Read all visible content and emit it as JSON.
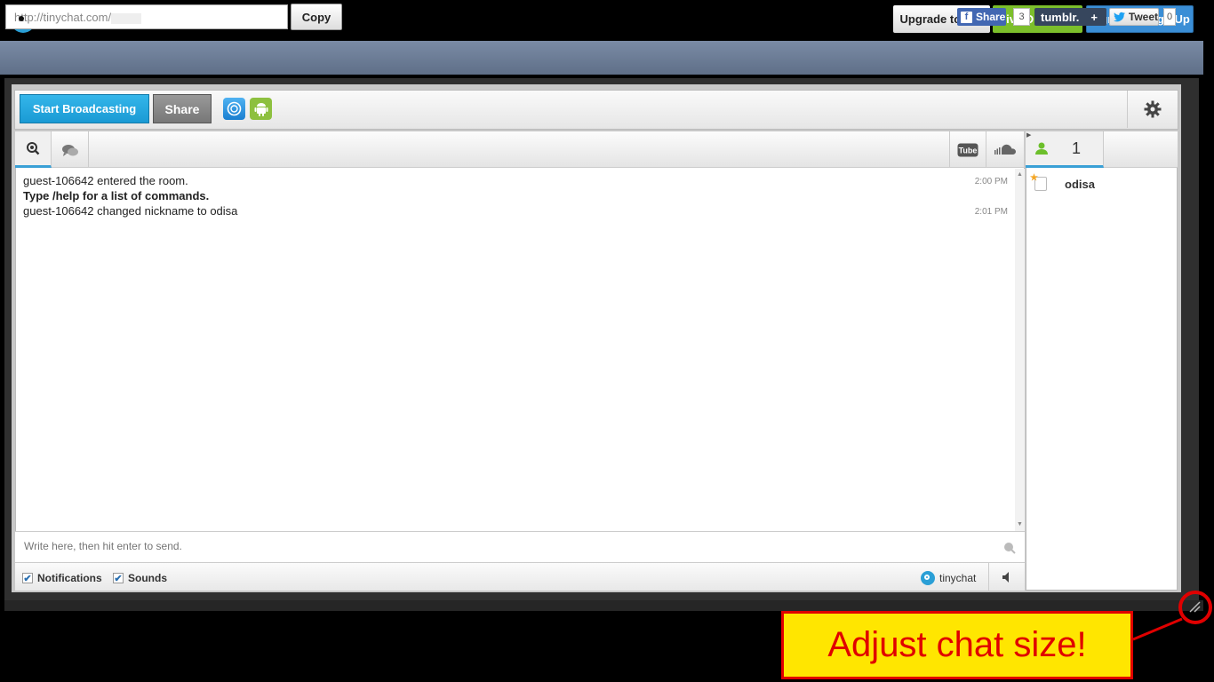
{
  "header": {
    "logo_text": "tinychat",
    "upgrade_label": "Upgrade to Pro",
    "directory_label": "Live Directory",
    "signin_label": "Sign In or Sign Up"
  },
  "urlbar": {
    "url_value": "http://tinychat.com/",
    "copy_label": "Copy",
    "fb_share_label": "Share",
    "fb_count": "3",
    "tumblr_label": "tumblr.",
    "tumblr_plus": "+",
    "tweet_label": "Tweet",
    "tweet_count": "0"
  },
  "toolbar": {
    "start_label": "Start Broadcasting",
    "share_label": "Share"
  },
  "messages": [
    {
      "text": "guest-106642 entered the room.",
      "time": "2:00 PM"
    },
    {
      "text": "Type /help for a list of commands.",
      "time": ""
    },
    {
      "text": "guest-106642 changed nickname to odisa",
      "time": "2:01 PM"
    }
  ],
  "input": {
    "placeholder": "Write here, then hit enter to send."
  },
  "footer": {
    "notifications_label": "Notifications",
    "sounds_label": "Sounds",
    "logo_text": "tinychat"
  },
  "users": {
    "count": "1",
    "list": [
      {
        "name": "odisa"
      }
    ]
  },
  "callout": {
    "text": "Adjust chat size!"
  },
  "colors": {
    "accent": "#1a9ad4",
    "green": "#7cbf2b",
    "callout_bg": "#ffe600",
    "callout_red": "#e00000"
  }
}
